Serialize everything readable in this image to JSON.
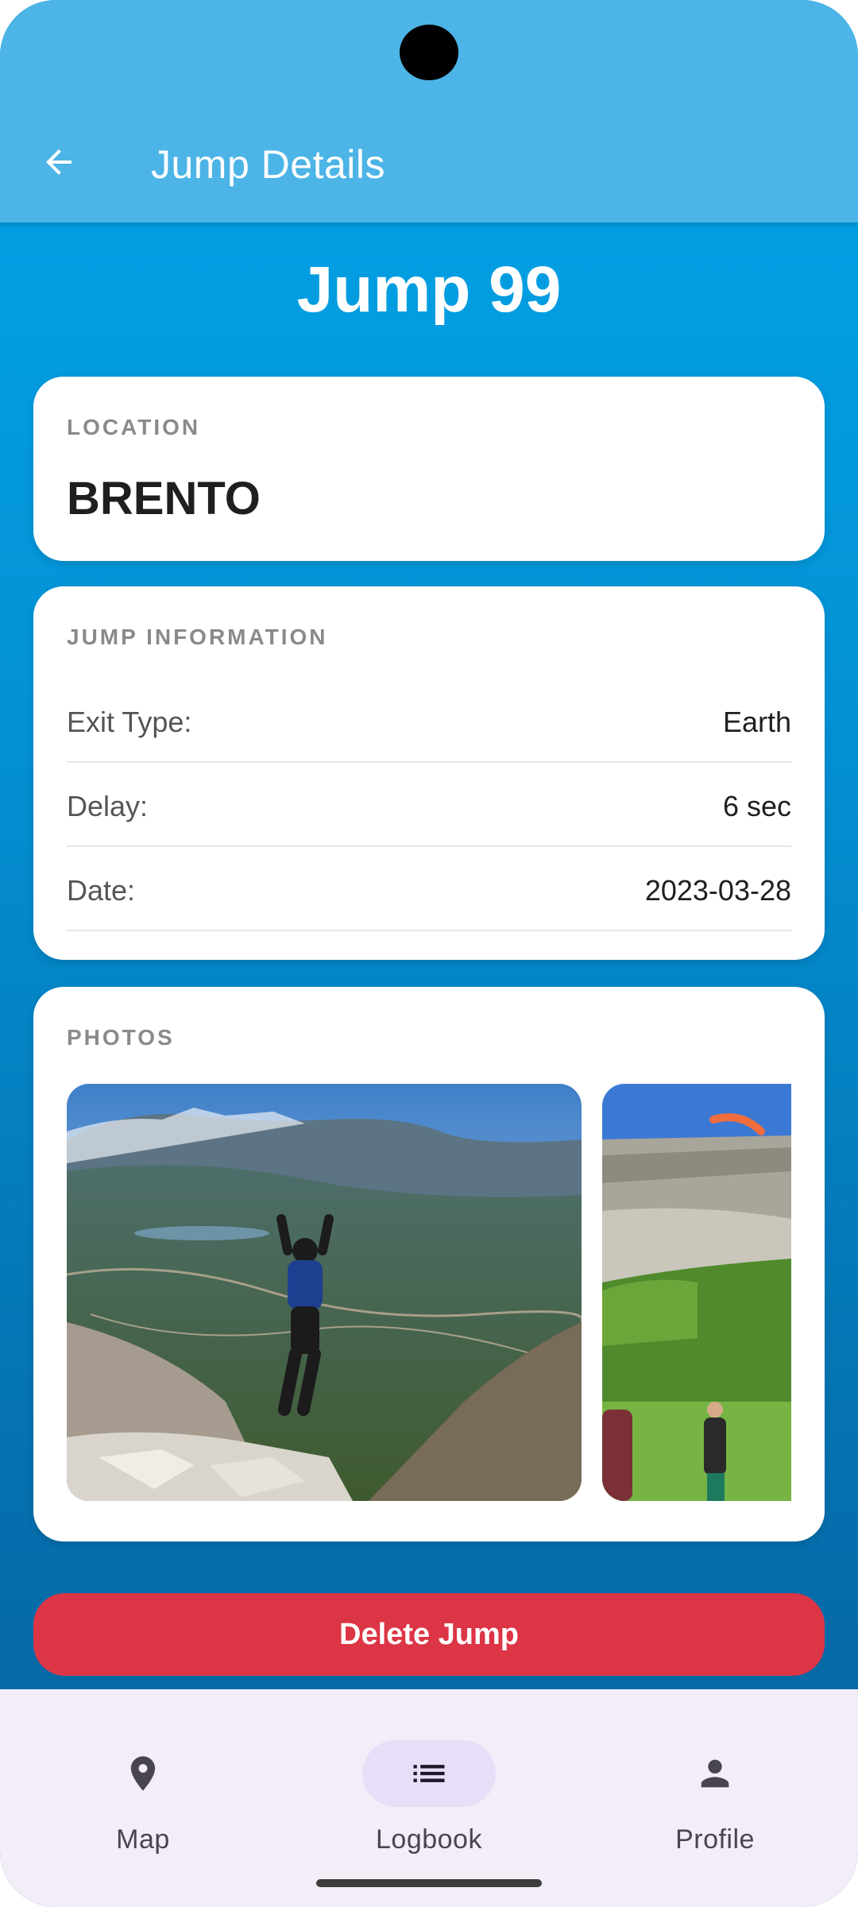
{
  "appbar": {
    "title": "Jump Details",
    "back_icon": "arrow-back-icon"
  },
  "jump": {
    "title": "Jump 99"
  },
  "location": {
    "label": "LOCATION",
    "value": "BRENTO"
  },
  "jump_information": {
    "label": "JUMP INFORMATION",
    "rows": [
      {
        "key": "Exit Type:",
        "value": "Earth"
      },
      {
        "key": "Delay:",
        "value": "6 sec"
      },
      {
        "key": "Date:",
        "value": "2023-03-28"
      }
    ]
  },
  "photos": {
    "label": "PHOTOS"
  },
  "actions": {
    "delete_label": "Delete Jump"
  },
  "bottom_nav": {
    "items": [
      {
        "label": "Map",
        "icon": "location-pin-icon"
      },
      {
        "label": "Logbook",
        "icon": "list-icon",
        "active": true
      },
      {
        "label": "Profile",
        "icon": "person-icon"
      }
    ]
  },
  "colors": {
    "appbar": "#4cb4e6",
    "background_top": "#02a4e9",
    "background_bottom": "#06609c",
    "delete": "#dc3545",
    "nav_background": "#f3edf7",
    "nav_active_pill": "#e8def8"
  }
}
